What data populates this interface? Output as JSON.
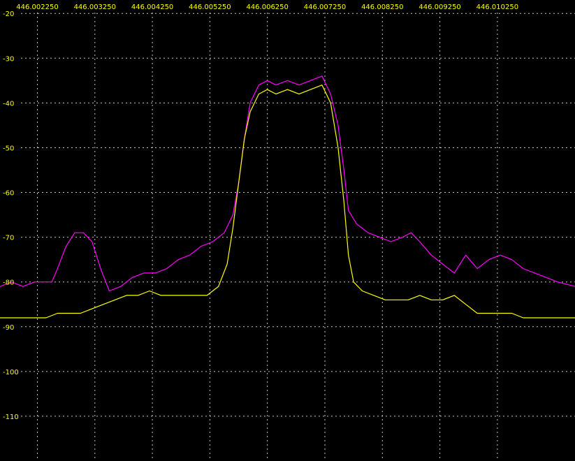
{
  "chart_data": {
    "type": "line",
    "title": "",
    "xlabel": "",
    "ylabel": "",
    "x_ticks": [
      "446.002250",
      "446.003250",
      "446.004250",
      "446.005250",
      "446.006250",
      "446.007250",
      "446.008250",
      "446.009250",
      "446.010250"
    ],
    "x_tick_values": [
      446.00225,
      446.00325,
      446.00425,
      446.00525,
      446.00625,
      446.00725,
      446.00825,
      446.00925,
      446.01025
    ],
    "y_ticks": [
      "-20",
      "-30",
      "-40",
      "-50",
      "-60",
      "-70",
      "-80",
      "-90",
      "-100",
      "-110"
    ],
    "y_tick_values": [
      -20,
      -30,
      -40,
      -50,
      -60,
      -70,
      -80,
      -90,
      -100,
      -110
    ],
    "xlim": [
      446.0016,
      446.0116
    ],
    "ylim": [
      -120,
      -17
    ],
    "grid": true,
    "colors": {
      "background": "#000000",
      "tick_text": "#ffff00",
      "grid": "#e8e8e8"
    },
    "series": [
      {
        "color": "#ff00ff",
        "points": [
          [
            446.0016,
            -81
          ],
          [
            446.0018,
            -80
          ],
          [
            446.002,
            -81
          ],
          [
            446.0022,
            -80
          ],
          [
            446.0024,
            -80
          ],
          [
            446.0025,
            -80
          ],
          [
            446.0026,
            -77
          ],
          [
            446.00275,
            -72
          ],
          [
            446.0029,
            -69
          ],
          [
            446.00305,
            -69
          ],
          [
            446.0032,
            -71
          ],
          [
            446.00335,
            -77
          ],
          [
            446.0035,
            -82
          ],
          [
            446.0037,
            -81
          ],
          [
            446.0039,
            -79
          ],
          [
            446.0041,
            -78
          ],
          [
            446.0043,
            -78
          ],
          [
            446.0045,
            -77
          ],
          [
            446.0047,
            -75
          ],
          [
            446.0049,
            -74
          ],
          [
            446.0051,
            -72
          ],
          [
            446.0053,
            -71
          ],
          [
            446.0055,
            -69
          ],
          [
            446.00565,
            -65
          ],
          [
            446.00575,
            -58
          ],
          [
            446.00585,
            -48
          ],
          [
            446.00595,
            -40
          ],
          [
            446.0061,
            -36
          ],
          [
            446.00625,
            -35
          ],
          [
            446.0064,
            -36
          ],
          [
            446.0066,
            -35
          ],
          [
            446.0068,
            -36
          ],
          [
            446.007,
            -35
          ],
          [
            446.0072,
            -34
          ],
          [
            446.00735,
            -38
          ],
          [
            446.00748,
            -45
          ],
          [
            446.00758,
            -55
          ],
          [
            446.00766,
            -64
          ],
          [
            446.0078,
            -67
          ],
          [
            446.008,
            -69
          ],
          [
            446.0082,
            -70
          ],
          [
            446.0084,
            -71
          ],
          [
            446.0086,
            -70
          ],
          [
            446.00875,
            -69
          ],
          [
            446.0089,
            -71
          ],
          [
            446.0091,
            -74
          ],
          [
            446.0093,
            -76
          ],
          [
            446.0095,
            -78
          ],
          [
            446.0097,
            -74
          ],
          [
            446.0099,
            -77
          ],
          [
            446.0101,
            -75
          ],
          [
            446.0103,
            -74
          ],
          [
            446.0105,
            -75
          ],
          [
            446.0107,
            -77
          ],
          [
            446.0109,
            -78
          ],
          [
            446.0111,
            -79
          ],
          [
            446.0113,
            -80
          ],
          [
            446.0116,
            -81
          ]
        ]
      },
      {
        "color": "#ffff00",
        "points": [
          [
            446.0016,
            -88
          ],
          [
            446.0018,
            -88
          ],
          [
            446.002,
            -88
          ],
          [
            446.0022,
            -88
          ],
          [
            446.0024,
            -88
          ],
          [
            446.0026,
            -87
          ],
          [
            446.0028,
            -87
          ],
          [
            446.003,
            -87
          ],
          [
            446.0032,
            -86
          ],
          [
            446.0034,
            -85
          ],
          [
            446.0036,
            -84
          ],
          [
            446.0038,
            -83
          ],
          [
            446.004,
            -83
          ],
          [
            446.0042,
            -82
          ],
          [
            446.0044,
            -83
          ],
          [
            446.0046,
            -83
          ],
          [
            446.0048,
            -83
          ],
          [
            446.005,
            -83
          ],
          [
            446.0052,
            -83
          ],
          [
            446.0054,
            -81
          ],
          [
            446.00555,
            -76
          ],
          [
            446.00565,
            -68
          ],
          [
            446.00575,
            -58
          ],
          [
            446.00585,
            -48
          ],
          [
            446.00595,
            -42
          ],
          [
            446.0061,
            -38
          ],
          [
            446.00625,
            -37
          ],
          [
            446.0064,
            -38
          ],
          [
            446.0066,
            -37
          ],
          [
            446.0068,
            -38
          ],
          [
            446.007,
            -37
          ],
          [
            446.0072,
            -36
          ],
          [
            446.00735,
            -40
          ],
          [
            446.00748,
            -50
          ],
          [
            446.00758,
            -62
          ],
          [
            446.00766,
            -74
          ],
          [
            446.00775,
            -80
          ],
          [
            446.0079,
            -82
          ],
          [
            446.0081,
            -83
          ],
          [
            446.0083,
            -84
          ],
          [
            446.0085,
            -84
          ],
          [
            446.0087,
            -84
          ],
          [
            446.0089,
            -83
          ],
          [
            446.0091,
            -84
          ],
          [
            446.0093,
            -84
          ],
          [
            446.0095,
            -83
          ],
          [
            446.0097,
            -85
          ],
          [
            446.0099,
            -87
          ],
          [
            446.0101,
            -87
          ],
          [
            446.0103,
            -87
          ],
          [
            446.0105,
            -87
          ],
          [
            446.0107,
            -88
          ],
          [
            446.0109,
            -88
          ],
          [
            446.0111,
            -88
          ],
          [
            446.0113,
            -88
          ],
          [
            446.0116,
            -88
          ]
        ]
      }
    ]
  }
}
